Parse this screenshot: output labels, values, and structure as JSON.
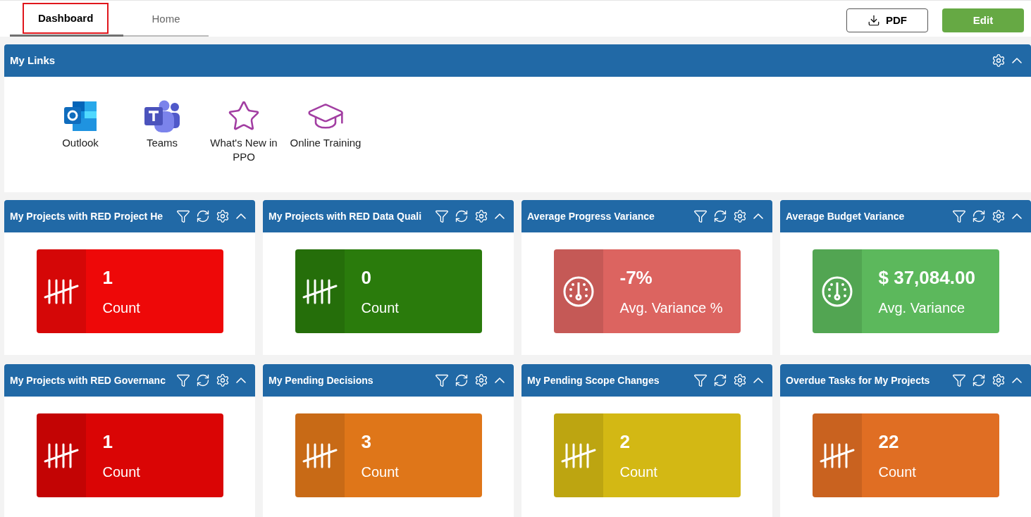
{
  "tabs": [
    {
      "label": "Dashboard",
      "selected": true
    },
    {
      "label": "Home",
      "selected": false
    }
  ],
  "buttons": [
    {
      "kind": "pdf",
      "label": "PDF"
    },
    {
      "kind": "edit",
      "label": "Edit"
    }
  ],
  "links_panel": {
    "title": "My Links",
    "links": [
      {
        "kind": "outlook",
        "label": "Outlook"
      },
      {
        "kind": "teams",
        "label": "Teams"
      },
      {
        "kind": "star",
        "label": "What's New in PPO"
      },
      {
        "kind": "training",
        "label": "Online Training"
      }
    ]
  },
  "widgets": [
    {
      "title": "My Projects with RED Project He",
      "kind": "tally",
      "color": "#ee0808",
      "value": "1",
      "caption": "Count"
    },
    {
      "title": "My Projects with RED Data Quali",
      "kind": "tally",
      "color": "#2a7b0c",
      "value": "0",
      "caption": "Count"
    },
    {
      "title": "Average Progress Variance",
      "kind": "gauge",
      "color": "#dc6460",
      "value": "-7%",
      "caption": "Avg. Variance %"
    },
    {
      "title": "Average Budget Variance",
      "kind": "gauge",
      "color": "#5cb85c",
      "value": "$ 37,084.00",
      "caption": "Avg. Variance"
    },
    {
      "title": "My Projects with RED Governanc",
      "kind": "tally",
      "color": "#da0505",
      "value": "1",
      "caption": "Count"
    },
    {
      "title": "My Pending Decisions",
      "kind": "tally",
      "color": "#df7619",
      "value": "3",
      "caption": "Count"
    },
    {
      "title": "My Pending Scope Changes",
      "kind": "tally",
      "color": "#d3b814",
      "value": "2",
      "caption": "Count"
    },
    {
      "title": "Overdue Tasks for My Projects",
      "kind": "tally",
      "color": "#e06e23",
      "value": "22",
      "caption": "Count"
    }
  ]
}
